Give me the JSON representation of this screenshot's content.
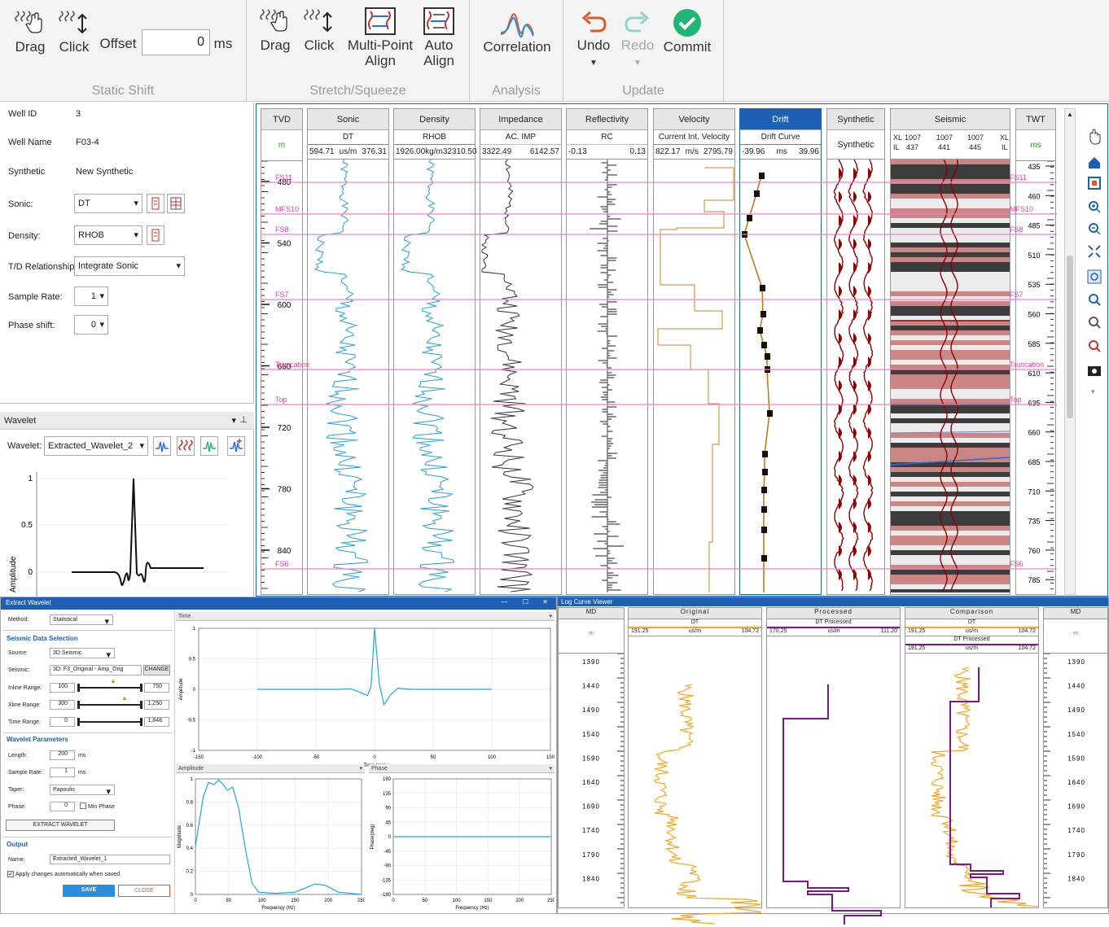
{
  "ribbon": {
    "drag": "Drag",
    "click": "Click",
    "offset_label": "Offset",
    "offset_value": "0",
    "offset_unit": "ms",
    "static_shift": "Static Shift",
    "drag2": "Drag",
    "click2": "Click",
    "multi_point_1": "Multi-Point",
    "multi_point_2": "Align",
    "auto_1": "Auto",
    "auto_2": "Align",
    "stretch": "Stretch/Squeeze",
    "correlation": "Correlation",
    "analysis": "Analysis",
    "undo": "Undo",
    "redo": "Redo",
    "commit": "Commit",
    "update": "Update"
  },
  "props": {
    "well_id_label": "Well ID",
    "well_id": "3",
    "well_name_label": "Well Name",
    "well_name": "F03-4",
    "synthetic_label": "Synthetic",
    "synthetic": "New Synthetic",
    "sonic_label": "Sonic:",
    "sonic": "DT",
    "density_label": "Density:",
    "density": "RHOB",
    "td_label": "T/D Relationship:",
    "td": "Integrate Sonic",
    "sample_label": "Sample Rate:",
    "sample": "1",
    "phase_label": "Phase shift:",
    "phase": "0"
  },
  "wavelet": {
    "panel_title": "Wavelet",
    "label": "Wavelet:",
    "value": "Extracted_Wavelet_2",
    "amplitude": "Amplitude",
    "y_ticks": [
      "1",
      "0.5",
      "0"
    ]
  },
  "tracks": {
    "tvd": {
      "title": "TVD",
      "unit": "m",
      "ticks": [
        "480",
        "540",
        "600",
        "660",
        "720",
        "780",
        "840"
      ]
    },
    "sonic": {
      "title": "Sonic",
      "curve": "DT",
      "min": "594.71",
      "unit": "us/m",
      "max": "376.31"
    },
    "density": {
      "title": "Density",
      "curve": "RHOB",
      "min": "1926.00",
      "unit": "kg/m3",
      "max": "2310.50"
    },
    "impedance": {
      "title": "Impedance",
      "curve": "AC. IMP",
      "min": "3322.49",
      "unit": "",
      "max": "6142.57"
    },
    "reflectivity": {
      "title": "Reflectivity",
      "curve": "RC",
      "min": "-0.13",
      "unit": "",
      "max": "0.13"
    },
    "velocity": {
      "title": "Velocity",
      "curve": "Current Int. Velocity",
      "min": "822.17",
      "unit": "m/s",
      "max": "2795.79"
    },
    "drift": {
      "title": "Drift",
      "curve": "Drift Curve",
      "min": "-39.96",
      "unit": "ms",
      "max": "39.96"
    },
    "synthetic": {
      "title": "Synthetic",
      "curve": "Synthetic"
    },
    "seismic": {
      "title": "Seismic",
      "xl": "XL",
      "il": "IL",
      "xl1": "1007",
      "il1": "437",
      "xl2": "1007",
      "il2": "441",
      "xl3": "1007",
      "il3": "445"
    },
    "twt": {
      "title": "TWT",
      "unit": "ms",
      "ticks": [
        "435",
        "460",
        "485",
        "510",
        "535",
        "560",
        "585",
        "610",
        "635",
        "660",
        "685",
        "710",
        "735",
        "760",
        "785"
      ]
    }
  },
  "markers": [
    "FS11",
    "MFS10",
    "FS8",
    "FS7",
    "Truncation",
    "Top",
    "FS6"
  ],
  "extract": {
    "title": "Extract Wavelet",
    "method_label": "Method:",
    "method": "Statistical",
    "seismic_section": "Seismic Data Selection",
    "source_label": "Source:",
    "source": "3D Seismic",
    "seismic_label": "Seismic:",
    "seismic": "3D: F3_Original - Amp_Orig",
    "change": "CHANGE",
    "inline_label": "Inline Range:",
    "inline_min": "100",
    "inline_max": "750",
    "xline_label": "Xline Range:",
    "xline_min": "300",
    "xline_max": "1,250",
    "time_label": "Time Range:",
    "time_min": "0",
    "time_max": "1,848",
    "params_section": "Wavelet Parameters",
    "length_label": "Length:",
    "length": "200",
    "length_unit": "ms",
    "srate_label": "Sample Rate:",
    "srate": "1",
    "srate_unit": "ms",
    "taper_label": "Taper:",
    "taper": "Papoulis",
    "phase_label": "Phase:",
    "phase": "0",
    "min_phase": "Min Phase",
    "extract_btn": "EXTRACT WAVELET",
    "output_section": "Output",
    "name_label": "Name:",
    "name": "Extracted_Wavelet_1",
    "apply": "Apply changes automatically when saved.",
    "save": "SAVE",
    "close": "CLOSE",
    "time_plot": {
      "title": "Time",
      "xlabel": "Time (ms)",
      "ylabel": "Amplitude",
      "x_ticks": [
        "-150",
        "-100",
        "-50",
        "0",
        "50",
        "100",
        "150"
      ],
      "y_ticks": [
        "1",
        "0.5",
        "0",
        "-0.5",
        "-1"
      ]
    },
    "amp_plot": {
      "title": "Amplitude",
      "xlabel": "Frequency (Hz)",
      "ylabel": "Magnitude",
      "x_ticks": [
        "0",
        "50",
        "100",
        "150",
        "200",
        "250"
      ],
      "y_ticks": [
        "1",
        "0.8",
        "0.6",
        "0.4",
        "0.2",
        "0"
      ]
    },
    "phase_plot": {
      "title": "Phase",
      "xlabel": "Frequency (Hz)",
      "ylabel": "Phase(deg)",
      "x_ticks": [
        "0",
        "50",
        "100",
        "150",
        "200",
        "250"
      ],
      "y_ticks": [
        "180",
        "135",
        "90",
        "45",
        "0",
        "-45",
        "-90",
        "-135",
        "-180"
      ]
    }
  },
  "lcv": {
    "title": "Log Curve Viewer",
    "md": "MD",
    "md_unit": "m",
    "original": "Original",
    "processed": "Processed",
    "comparison": "Comparison",
    "dt": "DT",
    "dt_processed": "DT Processed",
    "min": "191.25",
    "unit": "us/m",
    "max": "104.72",
    "pmin": "170.25",
    "pmax": "111.20",
    "ticks": [
      "1390",
      "1440",
      "1490",
      "1540",
      "1590",
      "1640",
      "1690",
      "1740",
      "1790",
      "1840"
    ]
  },
  "colors": {
    "accent": "#1f5fb4",
    "sonic": "#2a9fd6",
    "marker": "#f080c0",
    "velocity": "#d08020",
    "drift": "#c07010",
    "seis_red": "#8b0000",
    "lcv_orange": "#f5a623",
    "lcv_purple": "#7a1a8a"
  }
}
